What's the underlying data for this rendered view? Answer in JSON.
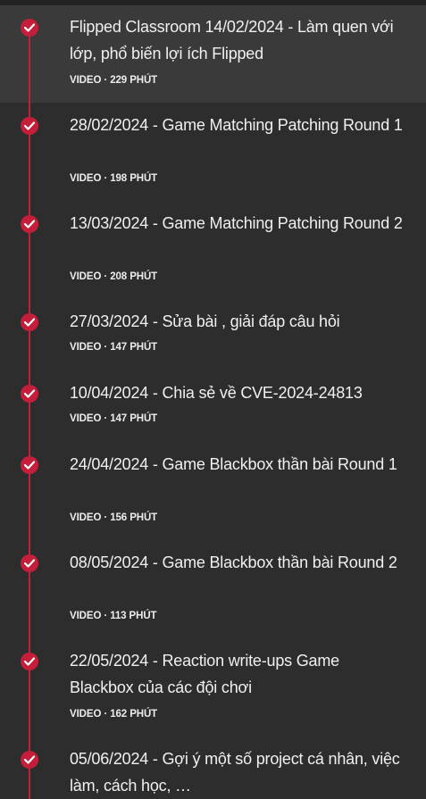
{
  "lessons": [
    {
      "title": "Flipped Classroom 14/02/2024 - Làm quen với lớp, phổ biến lợi ích Flipped",
      "type": "VIDEO",
      "duration": "229 PHÚT",
      "meta": "VIDEO · 229 PHÚT",
      "completed": true,
      "active": true
    },
    {
      "title": "28/02/2024 - Game Matching Patching Round 1",
      "type": "VIDEO",
      "duration": "198 PHÚT",
      "meta": "VIDEO · 198 PHÚT",
      "completed": true,
      "active": false
    },
    {
      "title": "13/03/2024 - Game Matching Patching Round 2",
      "type": "VIDEO",
      "duration": "208 PHÚT",
      "meta": "VIDEO · 208 PHÚT",
      "completed": true,
      "active": false
    },
    {
      "title": "27/03/2024 - Sửa bài , giải đáp câu hỏi",
      "type": "VIDEO",
      "duration": "147 PHÚT",
      "meta": "VIDEO · 147 PHÚT",
      "completed": true,
      "active": false
    },
    {
      "title": "10/04/2024 - Chia sẻ về CVE-2024-24813",
      "type": "VIDEO",
      "duration": "147 PHÚT",
      "meta": "VIDEO · 147 PHÚT",
      "completed": true,
      "active": false
    },
    {
      "title": "24/04/2024 - Game Blackbox thần bài Round 1",
      "type": "VIDEO",
      "duration": "156 PHÚT",
      "meta": "VIDEO · 156 PHÚT",
      "completed": true,
      "active": false
    },
    {
      "title": "08/05/2024 - Game Blackbox thần bài Round 2",
      "type": "VIDEO",
      "duration": "113 PHÚT",
      "meta": "VIDEO · 113 PHÚT",
      "completed": true,
      "active": false
    },
    {
      "title": "22/05/2024 - Reaction write-ups Game Blackbox của các đội chơi",
      "type": "VIDEO",
      "duration": "162 PHÚT",
      "meta": "VIDEO · 162 PHÚT",
      "completed": true,
      "active": false
    },
    {
      "title": "05/06/2024 - Gợi ý một số project cá nhân, việc làm, cách học, …",
      "type": "VIDEO",
      "duration": "",
      "meta": "",
      "completed": true,
      "active": false
    }
  ],
  "colors": {
    "background": "#2d2d2d",
    "active_row": "#3a3a3a",
    "accent": "#c41e3a",
    "text": "#f0f0f0"
  },
  "icons": {
    "completed": "check-circle-icon"
  }
}
